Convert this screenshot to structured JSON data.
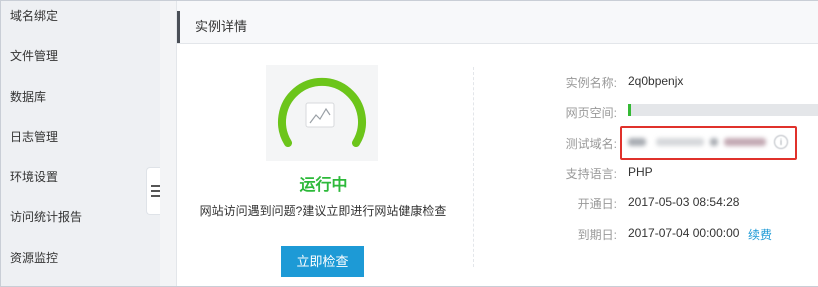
{
  "sidebar": {
    "items": [
      {
        "label": "域名绑定"
      },
      {
        "label": "文件管理"
      },
      {
        "label": "数据库"
      },
      {
        "label": "日志管理"
      },
      {
        "label": "环境设置"
      },
      {
        "label": "访问统计报告"
      },
      {
        "label": "资源监控"
      }
    ]
  },
  "panel": {
    "title": "实例详情",
    "status_text": "运行中",
    "tip_text": "网站访问遇到问题?建议立即进行网站健康检查",
    "check_button": "立即检查"
  },
  "info": {
    "name_label": "实例名称:",
    "name_value": "2q0bpenjx",
    "space_label": "网页空间:",
    "space_used_fraction": 0.01,
    "domain_label": "测试域名:",
    "lang_label": "支持语言:",
    "lang_value": "PHP",
    "open_label": "开通日:",
    "open_value": "2017-05-03 08:54:28",
    "expire_label": "到期日:",
    "expire_value": "2017-07-04 00:00:00",
    "renew_link": "续费"
  },
  "colors": {
    "status_green": "#2db93a",
    "primary_blue": "#1d9ad6",
    "highlight_red": "#e0312b"
  },
  "icons": {
    "gauge": "speed-gauge-icon",
    "collapse": "hamburger-icon",
    "info": "info-icon"
  }
}
